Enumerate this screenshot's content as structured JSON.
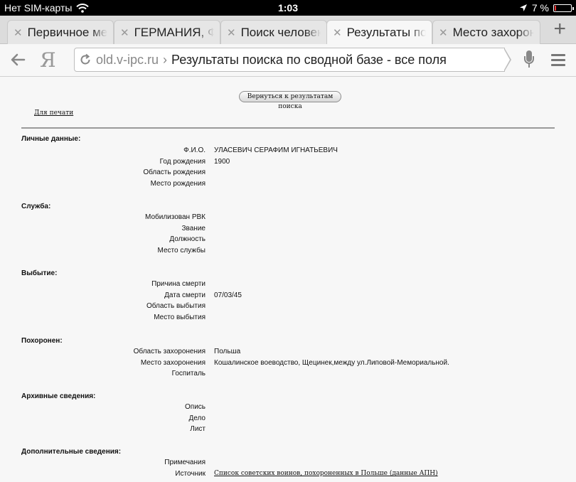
{
  "status_bar": {
    "carrier": "Нет SIM-карты",
    "time": "1:03",
    "battery": "7 %",
    "battery_level": 0.07
  },
  "tabs": [
    {
      "label": "Первичное мест",
      "active": false
    },
    {
      "label": "ГЕРМАНИЯ, Фе",
      "active": false
    },
    {
      "label": "Поиск человека",
      "active": false
    },
    {
      "label": "Результаты пои",
      "active": true
    },
    {
      "label": "Место захороне",
      "active": false
    }
  ],
  "toolbar": {
    "logo": "Я",
    "domain": "old.v-ipc.ru",
    "separator": "›",
    "page_title": "Результаты поиска по сводной базе - все поля"
  },
  "page": {
    "return_button": "Вернуться к результатам поиска",
    "print_link": "Для печати",
    "sections": [
      {
        "title": "Личные данные:",
        "rows": [
          {
            "label": "Ф.И.О.",
            "value": "УЛАСЕВИЧ СЕРАФИМ ИГНАТЬЕВИЧ"
          },
          {
            "label": "Год рождения",
            "value": "1900"
          },
          {
            "label": "Область рождения",
            "value": ""
          },
          {
            "label": "Место рождения",
            "value": ""
          }
        ]
      },
      {
        "title": "Служба:",
        "rows": [
          {
            "label": "Мобилизован РВК",
            "value": ""
          },
          {
            "label": "Звание",
            "value": ""
          },
          {
            "label": "Должность",
            "value": ""
          },
          {
            "label": "Место службы",
            "value": ""
          }
        ]
      },
      {
        "title": "Выбытие:",
        "rows": [
          {
            "label": "Причина смерти",
            "value": ""
          },
          {
            "label": "Дата смерти",
            "value": "07/03/45"
          },
          {
            "label": "Область выбытия",
            "value": ""
          },
          {
            "label": "Место выбытия",
            "value": ""
          }
        ]
      },
      {
        "title": "Похоронен:",
        "rows": [
          {
            "label": "Область захоронения",
            "value": "Польша"
          },
          {
            "label": "Место захоронения",
            "value": "Кошалинское воеводство, Щецинек,между ул.Липовой-Мемориальной."
          },
          {
            "label": "Госпиталь",
            "value": ""
          }
        ]
      },
      {
        "title": "Архивные сведения:",
        "rows": [
          {
            "label": "Опись",
            "value": ""
          },
          {
            "label": "Дело",
            "value": ""
          },
          {
            "label": "Лист",
            "value": ""
          }
        ]
      },
      {
        "title": "Дополнительные сведения:",
        "rows": [
          {
            "label": "Примечания",
            "value": ""
          },
          {
            "label": "Источник",
            "value": "Список советских воинов, похороненных в Польше (данные АПН)",
            "link": true
          }
        ]
      }
    ]
  }
}
